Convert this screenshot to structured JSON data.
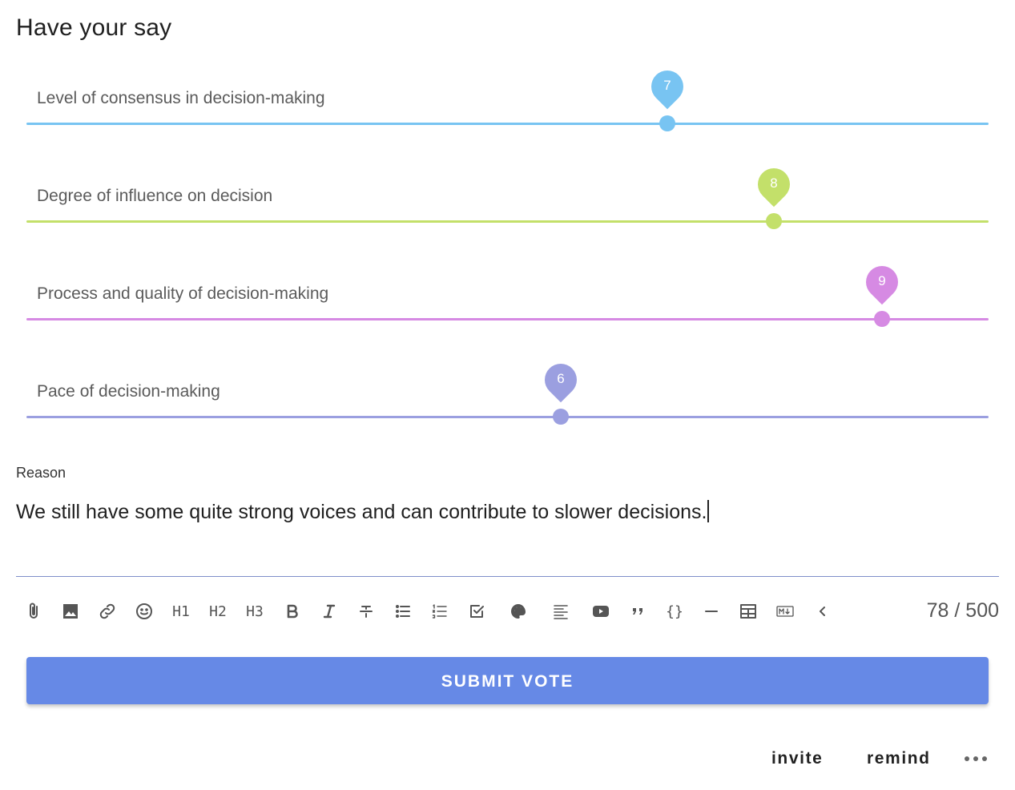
{
  "page": {
    "title": "Have your say"
  },
  "sliders": [
    {
      "label": "Level of consensus in decision-making",
      "value": "7",
      "fraction": 0.666,
      "color": "#78c4f2"
    },
    {
      "label": "Degree of influence on decision",
      "value": "8",
      "fraction": 0.777,
      "color": "#c3e06a"
    },
    {
      "label": "Process and quality of decision-making",
      "value": "9",
      "fraction": 0.889,
      "color": "#d68ae3"
    },
    {
      "label": "Pace of decision-making",
      "value": "6",
      "fraction": 0.555,
      "color": "#9b9fe0"
    }
  ],
  "reason": {
    "label": "Reason",
    "text": "We still have some quite strong voices and can contribute to slower decisions.",
    "counter": "78 / 500"
  },
  "toolbar": {
    "icons": [
      "attach-icon",
      "image-icon",
      "link-icon",
      "emoji-icon",
      "h1",
      "h2",
      "h3",
      "bold-icon",
      "italic-icon",
      "strikethrough-icon",
      "bullet-list-icon",
      "numbered-list-icon",
      "task-list-icon",
      "palette-icon",
      "align-icon",
      "video-icon",
      "quote-icon",
      "code-icon",
      "horizontal-rule-icon",
      "table-icon",
      "markdown-icon",
      "collapse-icon"
    ],
    "h1": "H1",
    "h2": "H2",
    "h3": "H3",
    "code": "{}"
  },
  "actions": {
    "submit": "SUBMIT VOTE",
    "invite": "invite",
    "remind": "remind"
  },
  "colors": {
    "accent": "#6689e6"
  }
}
